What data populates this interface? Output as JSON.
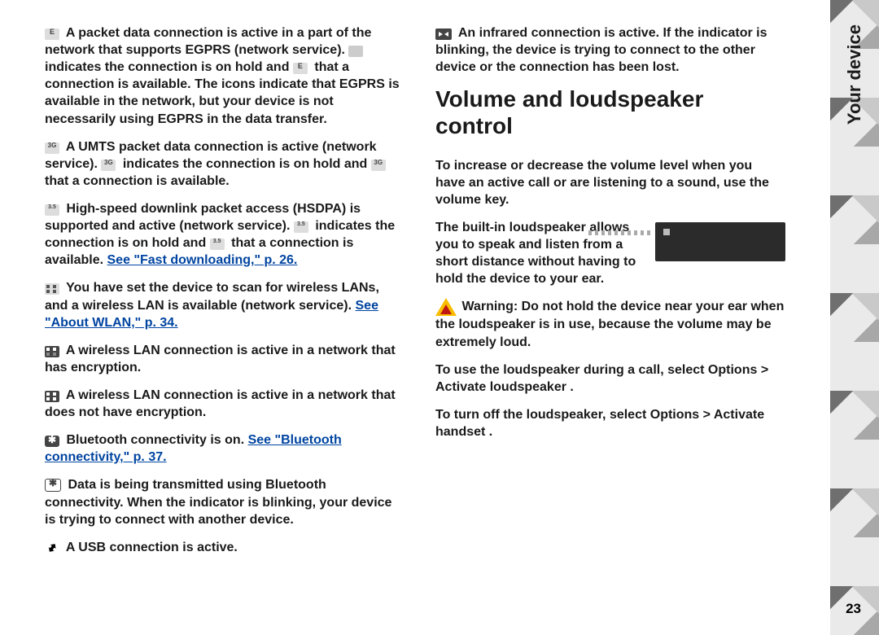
{
  "sidetab": "Your device",
  "page_number": "23",
  "left": {
    "p1": {
      "t1": "A packet data connection is active in a part of the network that supports EGPRS (network service). ",
      "t2": " indicates the connection is on hold and ",
      "t3": " that a connection is available. The icons indicate that EGPRS is available in the network, but your device is not necessarily using EGPRS in the data transfer."
    },
    "p2": {
      "t1": "A UMTS packet data connection is active (network service). ",
      "t2": " indicates the connection is on hold and ",
      "t3": " that a connection is available."
    },
    "p3": {
      "t1": "High-speed downlink packet access (HSDPA) is supported and active (network service). ",
      "t2": " indicates the connection is on hold and ",
      "t3": " that a connection is available. ",
      "link": "See \"Fast downloading,\" p. 26."
    },
    "p4": {
      "t1": "You have set the device to scan for wireless LANs, and a wireless LAN is available (network service). ",
      "link": "See \"About WLAN,\" p. 34."
    },
    "p5": "A wireless LAN connection is active in a network that has encryption.",
    "p6": "A wireless LAN connection is active in a network that does not have encryption.",
    "p7": {
      "t1": "Bluetooth connectivity is on. ",
      "link": "See \"Bluetooth connectivity,\" p. 37."
    },
    "p8": "Data is being transmitted using Bluetooth connectivity. When the indicator is blinking, your device is trying to connect with another device.",
    "p9": "A USB connection is active."
  },
  "right": {
    "p1": "An infrared connection is active. If the indicator is blinking, the device is trying to connect to the other device or the connection has been lost.",
    "heading": "Volume and loudspeaker control",
    "p2": "To increase or decrease the volume level when you have an active call or are listening to a sound, use the volume key.",
    "p3": "The built-in loudspeaker allows you to speak and listen from a short distance without having to hold the device to your ear.",
    "warn_label": "Warning:  ",
    "warn_body": "Do not hold the device near your ear when the loudspeaker is in use, because the volume may be extremely loud.",
    "p5a": "To use the loudspeaker during a call, select ",
    "p5b": "Options",
    "p5c": " > ",
    "p5d": "Activate loudspeaker",
    "p5e": ".",
    "p6a": "To turn off the loudspeaker, select ",
    "p6b": "Options",
    "p6c": " > ",
    "p6d": "Activate handset",
    "p6e": "."
  }
}
